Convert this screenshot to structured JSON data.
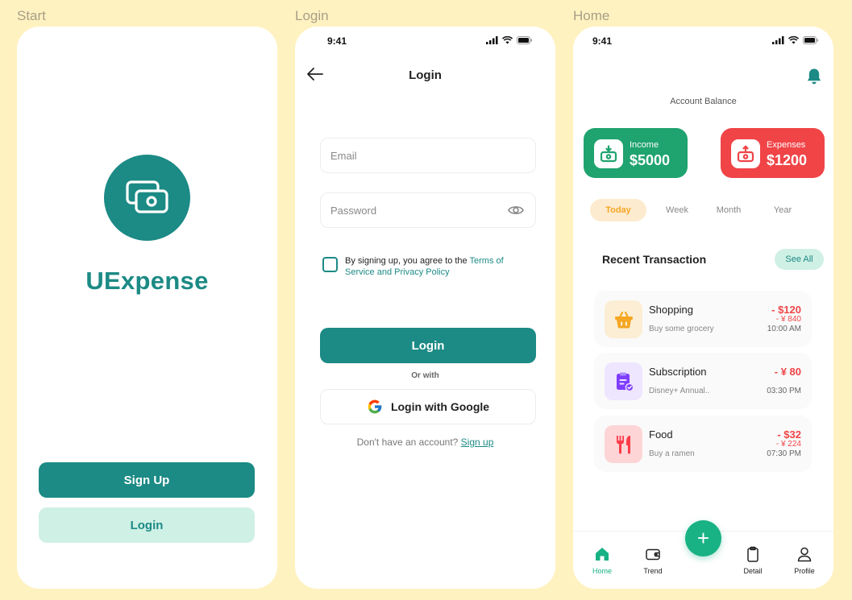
{
  "labels": {
    "start": "Start",
    "login": "Login",
    "home": "Home"
  },
  "colors": {
    "primary": "#1C8A85",
    "primary_soft": "#CFF0E5",
    "income": "#1FA36F",
    "expense": "#F04447",
    "accent_tab": "#F5A623",
    "fab": "#19B284",
    "background": "#FFF2C1"
  },
  "start": {
    "app_name": "UExpense",
    "logo_icon": "money-icon",
    "signup_button": "Sign Up",
    "login_button": "Login"
  },
  "status_bar": {
    "time": "9:41"
  },
  "login": {
    "title": "Login",
    "email_placeholder": "Email",
    "password_placeholder": "Password",
    "terms_text": "By signing up, you agree to the ",
    "terms_link": "Terms of Service and Privacy Policy",
    "login_button": "Login",
    "or_with": "Or with",
    "google_button": "Login with Google",
    "no_account": "Don't have an account? ",
    "signup_link": "Sign up"
  },
  "home": {
    "balance_label": "Account Balance",
    "income": {
      "label": "Income",
      "amount": "$5000"
    },
    "expenses": {
      "label": "Expenses",
      "amount": "$1200"
    },
    "tabs": [
      {
        "label": "Today",
        "active": true
      },
      {
        "label": "Week",
        "active": false
      },
      {
        "label": "Month",
        "active": false
      },
      {
        "label": "Year",
        "active": false
      }
    ],
    "recent_title": "Recent Transaction",
    "see_all": "See All",
    "transactions": [
      {
        "name": "Shopping",
        "desc": "Buy some grocery",
        "amount": "- $120",
        "sub": "- ¥ 840",
        "time": "10:00 AM",
        "icon": "shopping-basket-icon",
        "icon_bg": "#FCEED4",
        "icon_color": "#F5A623"
      },
      {
        "name": "Subscription",
        "desc": "Disney+ Annual..",
        "amount": "- ¥ 80",
        "sub": "",
        "time": "03:30 PM",
        "icon": "subscription-icon",
        "icon_bg": "#EEE5FF",
        "icon_color": "#7F3DFF"
      },
      {
        "name": "Food",
        "desc": "Buy a ramen",
        "amount": "- $32",
        "sub": "- ¥ 224",
        "time": "07:30 PM",
        "icon": "fork-knife-icon",
        "icon_bg": "#FDD5D7",
        "icon_color": "#FD3C4A"
      }
    ],
    "nav": [
      {
        "label": "Home",
        "icon": "home-icon",
        "active": true
      },
      {
        "label": "Trend",
        "icon": "wallet-icon",
        "active": false
      },
      {
        "label": "Detail",
        "icon": "clipboard-icon",
        "active": false
      },
      {
        "label": "Profile",
        "icon": "user-icon",
        "active": false
      }
    ],
    "fab": "+"
  }
}
